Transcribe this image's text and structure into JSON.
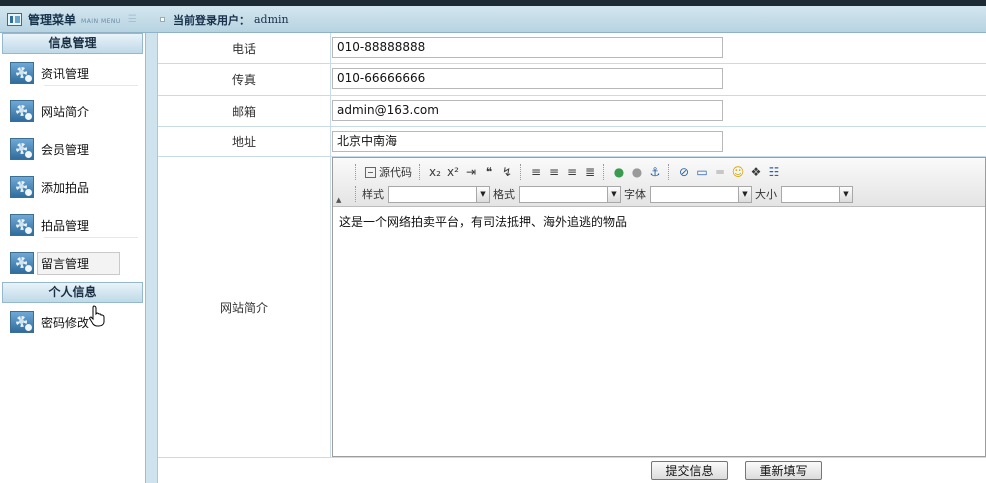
{
  "header": {
    "menu_title": "管理菜单",
    "menu_subtitle": "MAIN MENU",
    "user_label": "当前登录用户：",
    "user_name": "admin"
  },
  "sidebar": {
    "sections": [
      {
        "title": "信息管理",
        "items": [
          {
            "label": "资讯管理"
          },
          {
            "label": "网站简介"
          },
          {
            "label": "会员管理"
          },
          {
            "label": "添加拍品"
          },
          {
            "label": "拍品管理"
          },
          {
            "label": "留言管理"
          }
        ]
      },
      {
        "title": "个人信息",
        "items": [
          {
            "label": "密码修改"
          }
        ]
      }
    ]
  },
  "form": {
    "rows": [
      {
        "label": "电话",
        "value": "010-88888888"
      },
      {
        "label": "传真",
        "value": "010-66666666"
      },
      {
        "label": "邮箱",
        "value": "admin@163.com"
      },
      {
        "label": "地址",
        "value": "北京中南海"
      }
    ],
    "intro_label": "网站简介",
    "intro_content": "这是一个网络拍卖平台，有司法抵押、海外追逃的物品"
  },
  "editor": {
    "source_label": "源代码",
    "style_label": "样式",
    "format_label": "格式",
    "font_label": "字体",
    "size_label": "大小",
    "icons": [
      "subscript-icon",
      "superscript-icon",
      "indent-icon",
      "blockquote-icon",
      "div-icon",
      "align-left-icon",
      "align-center-icon",
      "align-right-icon",
      "justify-icon",
      "link-icon",
      "unlink-icon",
      "anchor-icon",
      "flash-icon",
      "table-icon",
      "horizontal-rule-icon",
      "smiley-icon",
      "special-char-icon",
      "page-break-icon"
    ]
  },
  "buttons": {
    "submit": "提交信息",
    "reset": "重新填写"
  }
}
